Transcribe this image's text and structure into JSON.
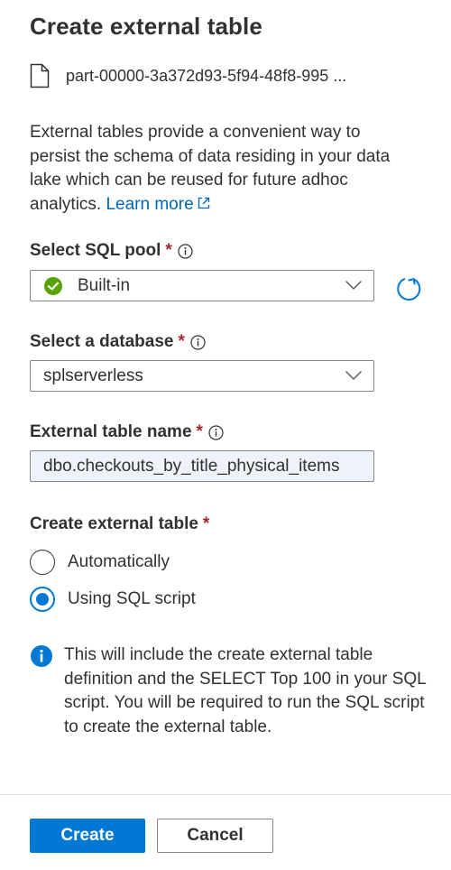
{
  "panel": {
    "title": "Create external table"
  },
  "file": {
    "name": "part-00000-3a372d93-5f94-48f8-995 ...",
    "icon": "file-icon"
  },
  "description": {
    "text": "External tables provide a convenient way to persist the schema of data residing in your data lake which can be reused for future adhoc analytics. ",
    "learn_more": "Learn more"
  },
  "sql_pool": {
    "label": "Select SQL pool",
    "required_marker": "*",
    "value": "Built-in",
    "status_color": "#57a300"
  },
  "database": {
    "label": "Select a database",
    "required_marker": "*",
    "value": "splserverless"
  },
  "table_name": {
    "label": "External table name",
    "required_marker": "*",
    "value": "dbo.checkouts_by_title_physical_items"
  },
  "create_mode": {
    "label": "Create external table",
    "required_marker": "*",
    "options": [
      {
        "label": "Automatically",
        "selected": false
      },
      {
        "label": "Using SQL script",
        "selected": true
      }
    ]
  },
  "info": {
    "text": "This will include the create external table definition and the SELECT Top 100 in your SQL script. You will be required to run the SQL script to create the external table."
  },
  "actions": {
    "create": "Create",
    "cancel": "Cancel"
  },
  "colors": {
    "accent": "#0078d4",
    "link": "#0067b8",
    "required": "#a4262c"
  }
}
